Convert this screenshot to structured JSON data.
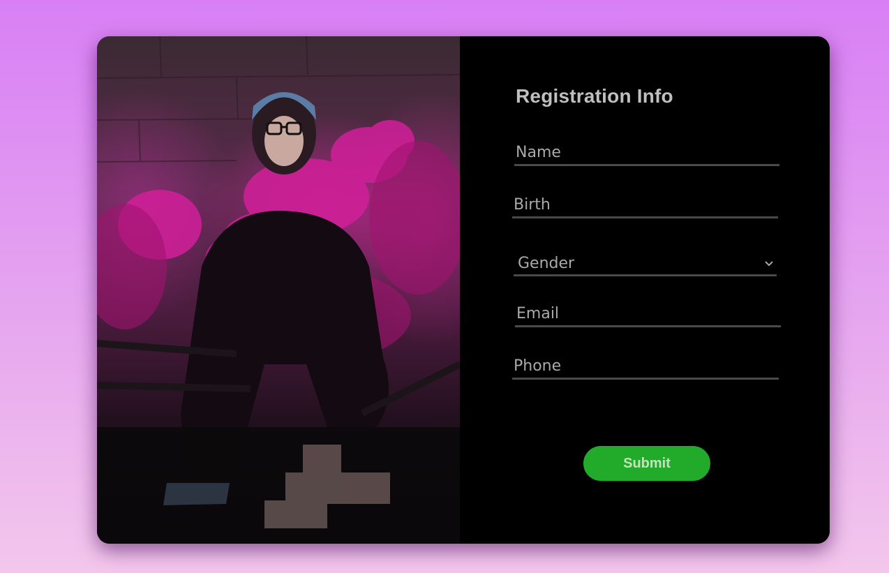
{
  "form": {
    "title": "Registration Info",
    "fields": [
      {
        "placeholder": "Name",
        "value": ""
      },
      {
        "placeholder": "Birth",
        "value": ""
      },
      {
        "placeholder": "Email",
        "value": ""
      },
      {
        "placeholder": "Phone",
        "value": ""
      }
    ],
    "gender_select": {
      "selected": "Gender"
    },
    "submit_label": "Submit"
  },
  "image": {
    "subject": "person-with-pink-smoke-flare"
  },
  "colors": {
    "page_gradient_top": "#d87ff5",
    "page_gradient_bottom": "#f3c7ec",
    "card_background": "#000000",
    "submit_button": "#22aa2b",
    "title_text": "#bfbfbf",
    "field_underline": "#4a4a4a"
  },
  "icons": {
    "select_chevron": "chevron-down-icon"
  }
}
